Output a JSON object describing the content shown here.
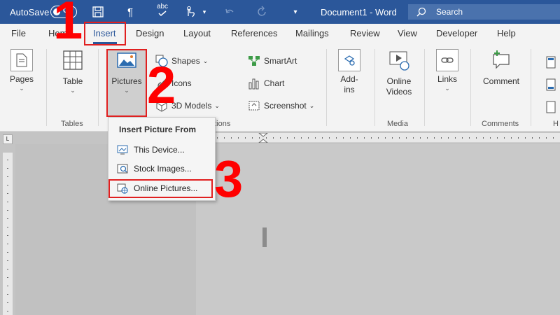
{
  "titlebar": {
    "autosave_label": "AutoSave",
    "autosave_state": "Off",
    "document_title": "Document1 - Word",
    "search_placeholder": "Search",
    "save_icon": "save-icon",
    "paragraph_icon": "¶",
    "spelling_icon": "abc"
  },
  "tabs": [
    {
      "label": "File"
    },
    {
      "label": "Home"
    },
    {
      "label": "Insert"
    },
    {
      "label": "Design"
    },
    {
      "label": "Layout"
    },
    {
      "label": "References"
    },
    {
      "label": "Mailings"
    },
    {
      "label": "Review"
    },
    {
      "label": "View"
    },
    {
      "label": "Developer"
    },
    {
      "label": "Help"
    }
  ],
  "ribbon": {
    "pages": "Pages",
    "table": "Table",
    "tables_group": "Tables",
    "pictures": "Pictures",
    "shapes": "Shapes",
    "icons": "Icons",
    "models_3d": "3D Models",
    "illustrations_group": "Illustrations",
    "smartart": "SmartArt",
    "chart": "Chart",
    "screenshot": "Screenshot",
    "addins_line1": "Add-",
    "addins_line2": "ins",
    "online_videos_line1": "Online",
    "online_videos_line2": "Videos",
    "media_group": "Media",
    "links": "Links",
    "comment": "Comment",
    "comments_group": "Comments",
    "header_footer_group": "H"
  },
  "dropdown": {
    "header": "Insert Picture From",
    "items": [
      {
        "label": "This Device..."
      },
      {
        "label": "Stock Images..."
      },
      {
        "label": "Online Pictures..."
      }
    ]
  },
  "annotations": {
    "step1": "1",
    "step2": "2",
    "step3": "3",
    "color": "#ff0000"
  },
  "colors": {
    "titlebar": "#2b579a",
    "ribbon": "#f3f3f3",
    "accent": "#2b579a"
  }
}
